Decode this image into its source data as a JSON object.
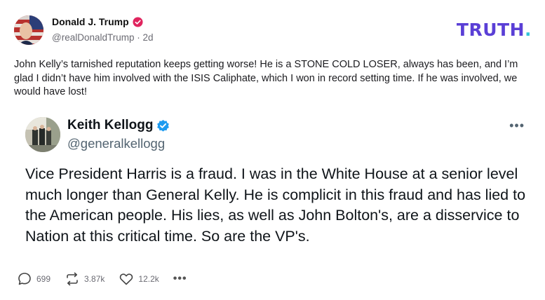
{
  "post": {
    "author_name": "Donald J. Trump",
    "handle": "@realDonaldTrump",
    "separator": "·",
    "time": "2d",
    "text": "John Kelly’s tarnished reputation keeps getting worse! He is a STONE COLD LOSER, always has been, and I’m glad I didn’t have him involved with the ISIS Caliphate, which I won in record setting time. If he was involved, we would have lost!"
  },
  "brand": {
    "logo_text": "TRUTH",
    "logo_dot": ".",
    "color": "#5a3fd6",
    "dot_color": "#33c5d8"
  },
  "quoted": {
    "name": "Keith Kellogg",
    "handle": "@generalkellogg",
    "more": "•••",
    "text": "Vice President Harris is a fraud. I was in the White House at a senior level much longer than General Kelly. He is complicit in this fraud and has lied to the American people.  His lies, as well as John Bolton's, are a disservice to Nation at this critical time. So are the VP's."
  },
  "actions": {
    "replies": "699",
    "retruths": "3.87k",
    "likes": "12.2k",
    "more": "•••"
  },
  "icons": {
    "verified": "verified-badge-icon",
    "quote_verified": "verified-check-icon",
    "reply": "reply-bubble-icon",
    "retruth": "retruth-arrows-icon",
    "like": "heart-icon",
    "more": "more-dots-icon"
  },
  "colors": {
    "verified_red": "#e0245e",
    "verified_blue": "#1d9bf0",
    "muted": "#6b6b73"
  }
}
